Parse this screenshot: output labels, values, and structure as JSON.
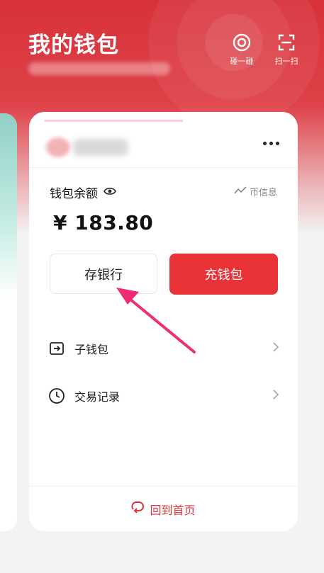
{
  "header": {
    "title": "我的钱包",
    "actions": [
      {
        "label": "碰一碰",
        "icon": "nfc-target-icon"
      },
      {
        "label": "扫一扫",
        "icon": "scan-icon"
      }
    ]
  },
  "wallet_card": {
    "balance_label": "钱包余额",
    "coin_info": "币信息",
    "amount": "¥ 183.80",
    "bank_button": "存银行",
    "topup_button": "充钱包",
    "items": [
      {
        "label": "子钱包",
        "icon": "sub-wallet-icon"
      },
      {
        "label": "交易记录",
        "icon": "clock-icon"
      }
    ],
    "home_link": "回到首页"
  },
  "colors": {
    "brand_red": "#e83236",
    "header_red": "#d8323a",
    "annotation_arrow": "#ee2d74"
  }
}
